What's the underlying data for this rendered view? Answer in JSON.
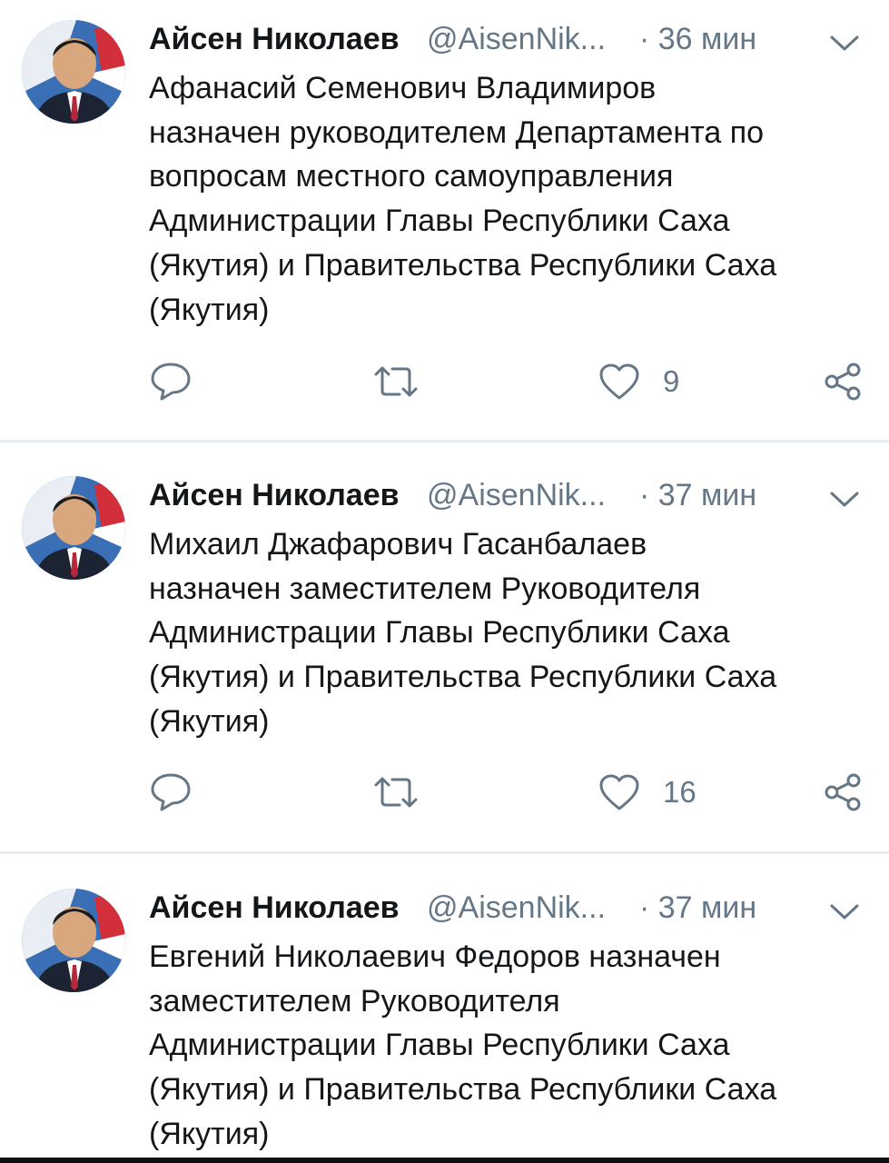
{
  "tweets": [
    {
      "author_name": "Айсен Николаев",
      "handle": "@AisenNik...",
      "time": "· 36 мин",
      "text": "Афанасий Семенович Владимиров\nназначен руководителем Департамента по\nвопросам местного самоуправления\nАдминистрации Главы Республики Саха\n(Якутия) и Правительства Республики Саха\n(Якутия)",
      "likes": "9"
    },
    {
      "author_name": "Айсен Николаев",
      "handle": "@AisenNik...",
      "time": "· 37 мин",
      "text": "Михаил Джафарович Гасанбалаев\nназначен заместителем Руководителя\nАдминистрации Главы Республики Саха\n(Якутия) и Правительства Республики Саха\n(Якутия)",
      "likes": "16"
    },
    {
      "author_name": "Айсен Николаев",
      "handle": "@AisenNik...",
      "time": "· 37 мин",
      "text": "Евгений Николаевич Федоров назначен\nзаместителем Руководителя\nАдминистрации Главы Республики Саха\n(Якутия) и Правительства Республики Саха\n(Якутия)",
      "likes": ""
    }
  ],
  "icons": {
    "avatar": "author-avatar-photo",
    "chevron": "chevron-down-icon",
    "reply": "reply-icon",
    "retweet": "retweet-icon",
    "like": "heart-icon",
    "share": "share-icon"
  },
  "colors": {
    "text": "#14171a",
    "secondary": "#657786",
    "divider": "#e6ecf0"
  }
}
